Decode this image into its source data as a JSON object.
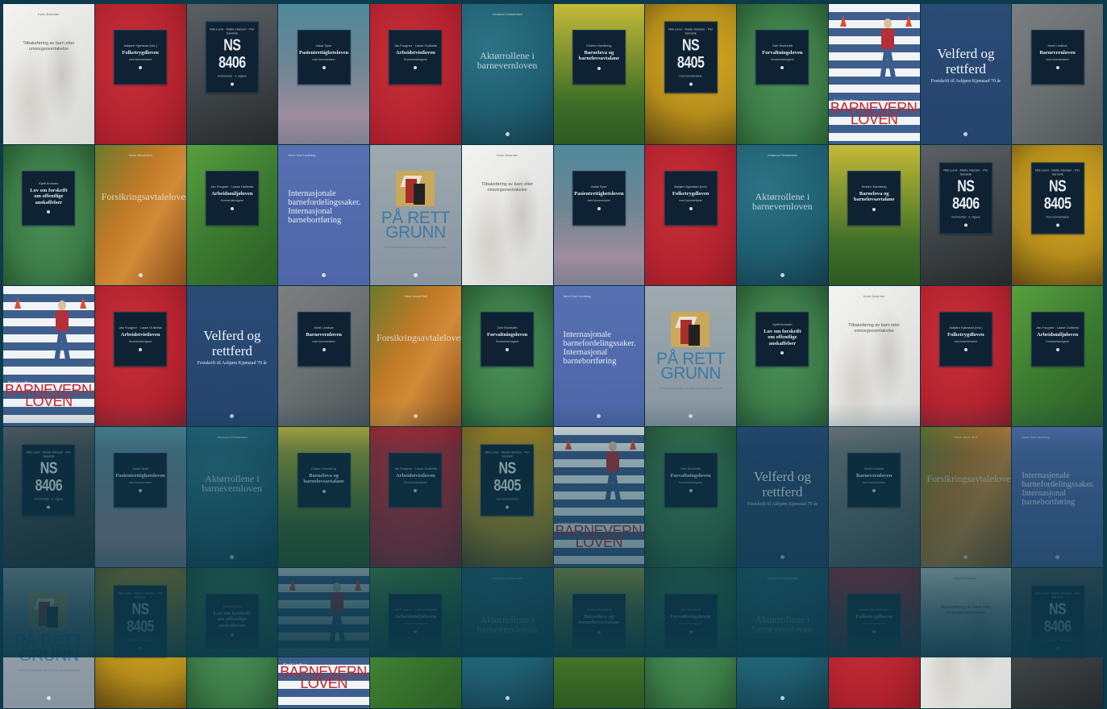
{
  "page": {
    "background": "#0c3a4a"
  },
  "cover_types": {
    "folketrygd": {
      "style": "plate",
      "bg": "red",
      "title": "Folketrygdloven",
      "author": "Asbjørn Kjønstad (red.)",
      "edition": "med kommentarer"
    },
    "ns8406": {
      "style": "plate",
      "bg": "crane-gray",
      "title": "NS 8406",
      "big": true,
      "author": "Nils Lund · Marte Hansen · Per Sandvik",
      "edition": "Kommentar · 3. utgave"
    },
    "pasient": {
      "style": "plate",
      "bg": "mauve",
      "title": "Pasientrettighetsloven",
      "author": "Aslak Syse",
      "edition": "med kommentarer"
    },
    "arbeidstvist": {
      "style": "plate",
      "bg": "red",
      "title": "Arbeidstvistloven",
      "author": "Jan Fougner · Lasse Gullbekk",
      "edition": "Kommentarutgave"
    },
    "akatt": {
      "style": "text",
      "bg": "blue-stone",
      "title": "Aktørrollene i barnevernloven",
      "author": "Johanna Christensen"
    },
    "barnelov": {
      "style": "plate",
      "bg": "yellow-green",
      "title": "Barnelova og barnelovsavtalane",
      "author": "Kirsten Sandberg"
    },
    "ns8405": {
      "style": "plate",
      "bg": "yellow-crane",
      "title": "NS 8405",
      "big": true,
      "author": "Nils Lund · Marte Hansen · Per Sandvik",
      "edition": "med kommentarer"
    },
    "forvaltnings": {
      "style": "plate",
      "bg": "green",
      "title": "Forvaltningsloven",
      "author": "Geir Woxholth",
      "edition": "Kommentarutgave"
    },
    "barnevernloven": {
      "style": "photo",
      "bg": "crosswalk",
      "title": "BARNEVERN-\nLOVEN",
      "author": "Kirsti Lindboe"
    },
    "velferd": {
      "style": "text",
      "bg": "navy",
      "title": "Velferd og rettferd",
      "sub": "Festskrift til Asbjørn Kjønstad 70 år"
    },
    "barnevern_gray": {
      "style": "plate",
      "bg": "stone",
      "title": "Barnevernloven",
      "author": "Kirsti Lindboe",
      "edition": "med kommentarer"
    },
    "lov_om_forskrift": {
      "style": "plate",
      "bg": "green",
      "title": "Lov om forskrift om offentlige anskaffelser",
      "author": "Kjetil Arvesen"
    },
    "forsikringsavtale": {
      "style": "text",
      "bg": "leaf",
      "title": "Forsikringsavtaleloven",
      "author": "Hans Jacob Bull"
    },
    "arbeidsmiljo": {
      "style": "plate",
      "bg": "green-light",
      "title": "Arbeidsmiljøloven",
      "author": "Jan Fougner · Lasse Gullbekk",
      "edition": "Kommentarutgave"
    },
    "internasjonale": {
      "style": "text-left",
      "bg": "periwinkle",
      "title": "Internasjonale barnefordelingssaker. Internasjonal barnebortføring",
      "author": "Anne Kari Lindberg"
    },
    "paa_rett": {
      "style": "pr",
      "bg": "gray-blue",
      "title": "PÅ RETT\nGRUNN",
      "sub": "Fremmedrettslige forhold og ulovlig opphold"
    },
    "tilbakeforing": {
      "style": "swoosh",
      "bg": "white",
      "title": "Tilbakeføring av barn etter omsorgsovertakelse",
      "author": "Karin Bolander"
    }
  },
  "grid": [
    [
      "tilbakeforing",
      "folketrygd",
      "ns8406",
      "pasient",
      "arbeidstvist",
      "akatt",
      "barnelov",
      "ns8405",
      "forvaltnings",
      "barnevernloven",
      "velferd",
      "barnevern_gray"
    ],
    [
      "lov_om_forskrift",
      "forsikringsavtale",
      "arbeidsmiljo",
      "internasjonale",
      "paa_rett",
      "tilbakeforing",
      "pasient",
      "folketrygd",
      "akatt",
      "barnelov",
      "ns8406",
      "ns8405"
    ],
    [
      "barnevernloven",
      "arbeidstvist",
      "velferd",
      "barnevern_gray",
      "forsikringsavtale",
      "forvaltnings",
      "internasjonale",
      "paa_rett",
      "lov_om_forskrift",
      "tilbakeforing",
      "folketrygd",
      "arbeidsmiljo"
    ],
    [
      "ns8406",
      "pasient",
      "akatt",
      "barnelov",
      "arbeidstvist",
      "ns8405",
      "barnevernloven",
      "forvaltnings",
      "velferd",
      "barnevern_gray",
      "forsikringsavtale",
      "internasjonale"
    ],
    [
      "paa_rett",
      "ns8405",
      "lov_om_forskrift",
      "barnevernloven",
      "arbeidsmiljo",
      "akatt",
      "barnelov",
      "forvaltnings",
      "akatt",
      "folketrygd",
      "tilbakeforing",
      "ns8406"
    ]
  ],
  "backgrounds": {
    "red": "#b3232f",
    "crane-gray": "#3e4448",
    "mauve": "#7e7f90",
    "blue-stone": "#1f5f72",
    "yellow-green": "#7f8a2a",
    "yellow-crane": "#b48c1b",
    "green": "#3c7a48",
    "green-light": "#4a8a3a",
    "crosswalk": "#e8eef2",
    "navy": "#25456e",
    "stone": "#6a6f72",
    "leaf": "#b57a2e",
    "periwinkle": "#4e66a8",
    "gray-blue": "#8b9ba0",
    "white": "#e6e7e6"
  }
}
